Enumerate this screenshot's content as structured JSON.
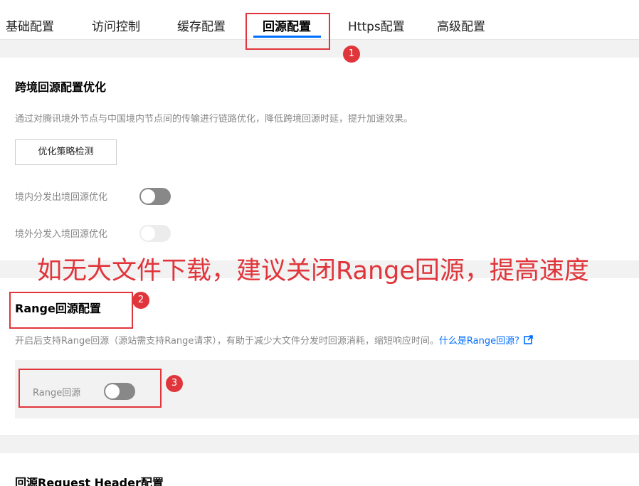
{
  "tabs": [
    {
      "label": "基础配置"
    },
    {
      "label": "访问控制"
    },
    {
      "label": "缓存配置"
    },
    {
      "label": "回源配置"
    },
    {
      "label": "Https配置"
    },
    {
      "label": "高级配置"
    }
  ],
  "cross_border": {
    "title": "跨境回源配置优化",
    "description": "通过对腾讯境外节点与中国境内节点间的传输进行链路优化，降低跨境回源时延，提升加速效果。",
    "check_button": "优化策略检测",
    "domestic_label": "境内分发出境回源优化",
    "overseas_label": "境外分发入境回源优化"
  },
  "annotation": {
    "overlay_text": "如无大文件下载，建议关闭Range回源，提高速度",
    "badge1": "1",
    "badge2": "2",
    "badge3": "3",
    "color": "#e0353b"
  },
  "range": {
    "title": "Range回源配置",
    "description": "开启后支持Range回源（源站需支持Range请求），有助于减少大文件分发时回源消耗，缩短响应时间。",
    "help_link": "什么是Range回源?",
    "toggle_label": "Range回源"
  },
  "request_header": {
    "title": "回源Request Header配置"
  },
  "colors": {
    "accent": "#006eff",
    "toggle_on": "#888888",
    "toggle_off": "#ececec"
  }
}
